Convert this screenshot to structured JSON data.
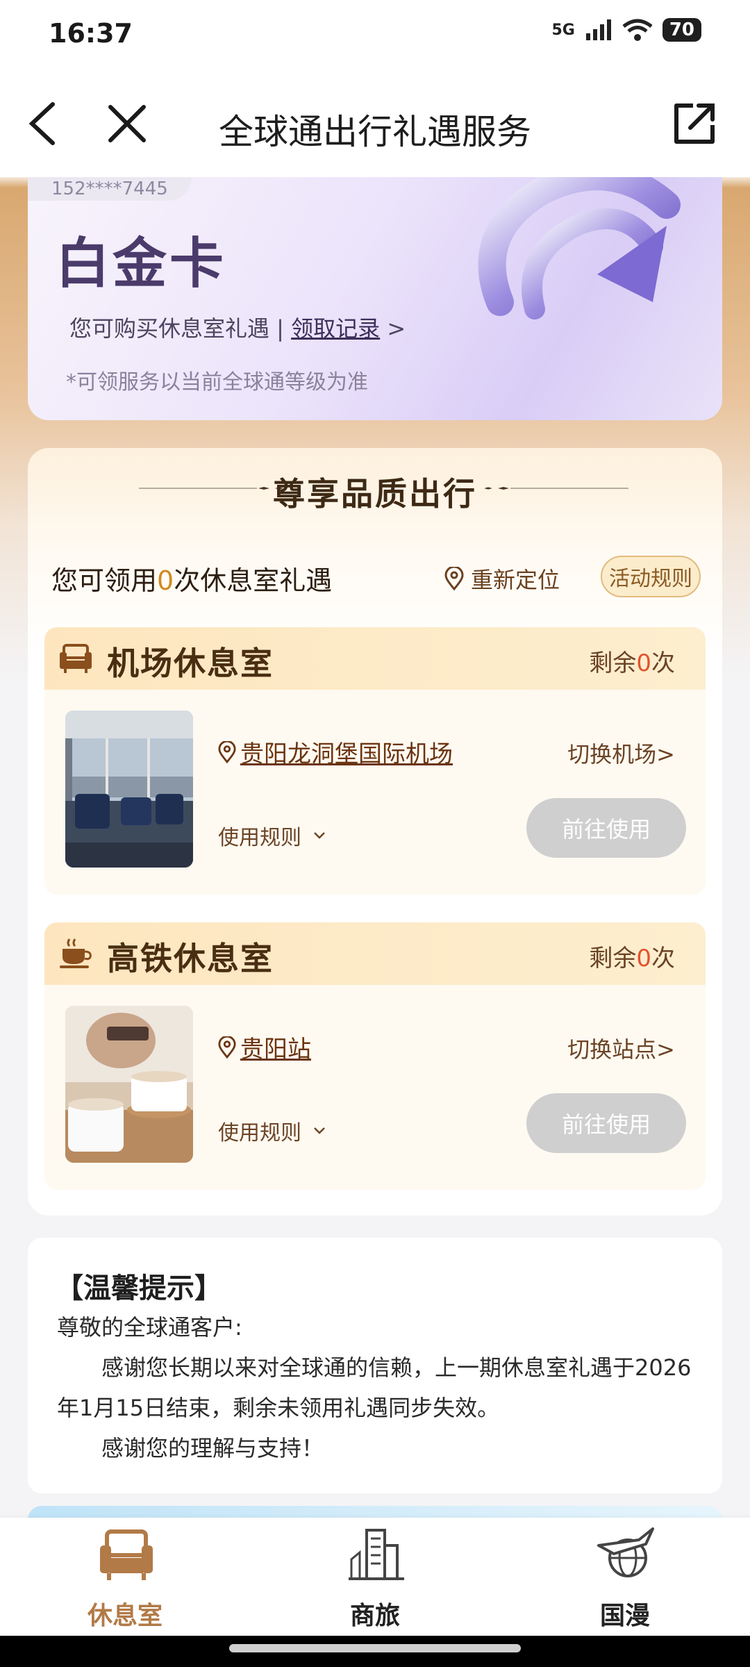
{
  "status_bar": {
    "time": "16:37",
    "network": "5G",
    "battery": "70"
  },
  "nav": {
    "title": "全球通出行礼遇服务"
  },
  "vip_card": {
    "phone": "152****7445",
    "tier": "白金卡",
    "line_prefix": "您可购买休息室礼遇 | ",
    "record_link": "领取记录",
    "record_arrow": ">",
    "note": "*可领服务以当前全球通等级为准"
  },
  "main": {
    "section_title": "尊享品质出行",
    "count_prefix": "您可领用",
    "count_value": "0",
    "count_suffix": "次休息室礼遇",
    "relocate": "重新定位",
    "rules": "活动规则",
    "lounges": [
      {
        "title": "机场休息室",
        "remain_prefix": "剩余",
        "remain_value": "0",
        "remain_suffix": "次",
        "location": "贵阳龙洞堡国际机场",
        "switch": "切换机场>",
        "use_rule": "使用规则",
        "go": "前往使用"
      },
      {
        "title": "高铁休息室",
        "remain_prefix": "剩余",
        "remain_value": "0",
        "remain_suffix": "次",
        "location": "贵阳站",
        "switch": "切换站点>",
        "use_rule": "使用规则",
        "go": "前往使用"
      }
    ]
  },
  "tips": {
    "title": "【温馨提示】",
    "greeting": "尊敬的全球通客户:",
    "body1": "感谢您长期以来对全球通的信赖，上一期休息室礼遇于2026年1月15日结束，剩余未领用礼遇同步失效。",
    "body2": "感谢您的理解与支持！"
  },
  "tabs": [
    {
      "label": "休息室",
      "icon": "sofa-icon",
      "active": true
    },
    {
      "label": "商旅",
      "icon": "city-icon",
      "active": false
    },
    {
      "label": "国漫",
      "icon": "globe-plane-icon",
      "active": false
    }
  ],
  "colors": {
    "accent": "#b27a47",
    "zero": "#e4522d",
    "count": "#d28a1f",
    "button_disabled": "#cfcfcf"
  }
}
